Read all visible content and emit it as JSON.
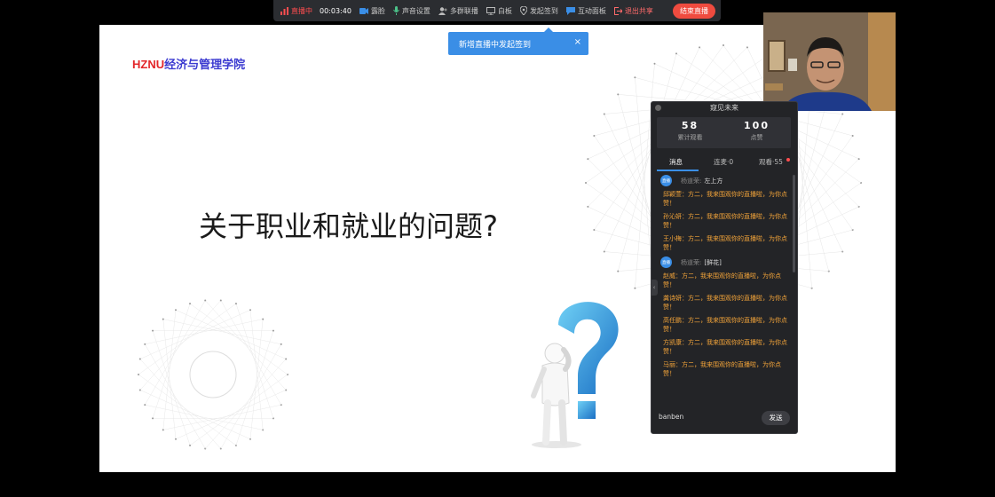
{
  "toolbar": {
    "live_status": "直播中",
    "duration": "00:03:40",
    "items": [
      "露脸",
      "声音设置",
      "多群联播",
      "白板",
      "发起签到",
      "互动面板"
    ],
    "stop_share": "退出共享",
    "end_live": "结束直播"
  },
  "notice": {
    "text": "新增直播中发起签到",
    "close": "×"
  },
  "slide": {
    "logo_prefix": "HZNU",
    "logo_suffix": "经济与管理学院",
    "title": "关于职业和就业的问题?"
  },
  "panel": {
    "title": "窥见未来",
    "stats": [
      {
        "value": "58",
        "label": "累计观看"
      },
      {
        "value": "100",
        "label": "点赞"
      }
    ],
    "tabs": [
      "消息",
      "连麦·0",
      "观看·55"
    ],
    "host_badge": "直播",
    "messages": [
      {
        "kind": "host",
        "name": "杨道荣:",
        "text": "左上方"
      },
      {
        "kind": "viewer",
        "text": "邱颖萱：方二，我来围观你的直播啦，为你点赞！"
      },
      {
        "kind": "viewer",
        "text": "孙沁妍：方二，我来围观你的直播啦，为你点赞！"
      },
      {
        "kind": "viewer",
        "text": "王小梅：方二，我来围观你的直播啦，为你点赞！"
      },
      {
        "kind": "host",
        "name": "杨道荣:",
        "text": "[鲜花]"
      },
      {
        "kind": "viewer",
        "text": "赵威：方二，我来围观你的直播啦，为你点赞！"
      },
      {
        "kind": "viewer",
        "text": "龚诗妍：方二，我来围观你的直播啦，为你点赞！"
      },
      {
        "kind": "viewer",
        "text": "高任鹏：方二，我来围观你的直播啦，为你点赞！"
      },
      {
        "kind": "viewer",
        "text": "方凯康：方二，我来围观你的直播啦，为你点赞！"
      },
      {
        "kind": "viewer",
        "text": "马丽：方二，我来围观你的直播啦，为你点赞！"
      }
    ],
    "input_value": "banben",
    "send": "发送"
  },
  "colors": {
    "accent": "#3a8ee6",
    "live_red": "#ef4b3f",
    "viewer_message": "#f3a43a"
  }
}
